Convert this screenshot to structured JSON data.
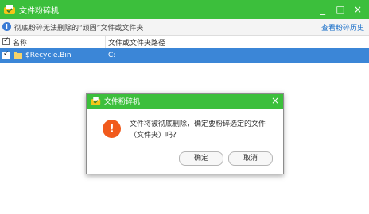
{
  "window": {
    "title": "文件粉碎机",
    "controls": [
      "_",
      "□",
      "×"
    ]
  },
  "infobar": {
    "text": "彻底粉碎无法删除的“顽固”文件或文件夹",
    "history_link": "查看粉碎历史"
  },
  "table": {
    "headers": {
      "name": "名称",
      "path": "文件或文件夹路径"
    },
    "rows": [
      {
        "name": "$Recycle.Bin",
        "path": "C:",
        "checked": true
      }
    ]
  },
  "dialog": {
    "title": "文件粉碎机",
    "close": "×",
    "warning_glyph": "!",
    "message": "文件将被彻底删除，确定要粉碎选定的文件（文件夹）吗？",
    "ok_label": "确定",
    "cancel_label": "取消"
  },
  "icons": {
    "app": "shredder-logo-icon",
    "info": "info-icon",
    "folder": "folder-icon",
    "warning": "warning-icon"
  },
  "colors": {
    "titlebar": "#3cbf3c",
    "selection": "#3b86d7",
    "warning": "#f15a1c",
    "link": "#1a6fc9"
  }
}
